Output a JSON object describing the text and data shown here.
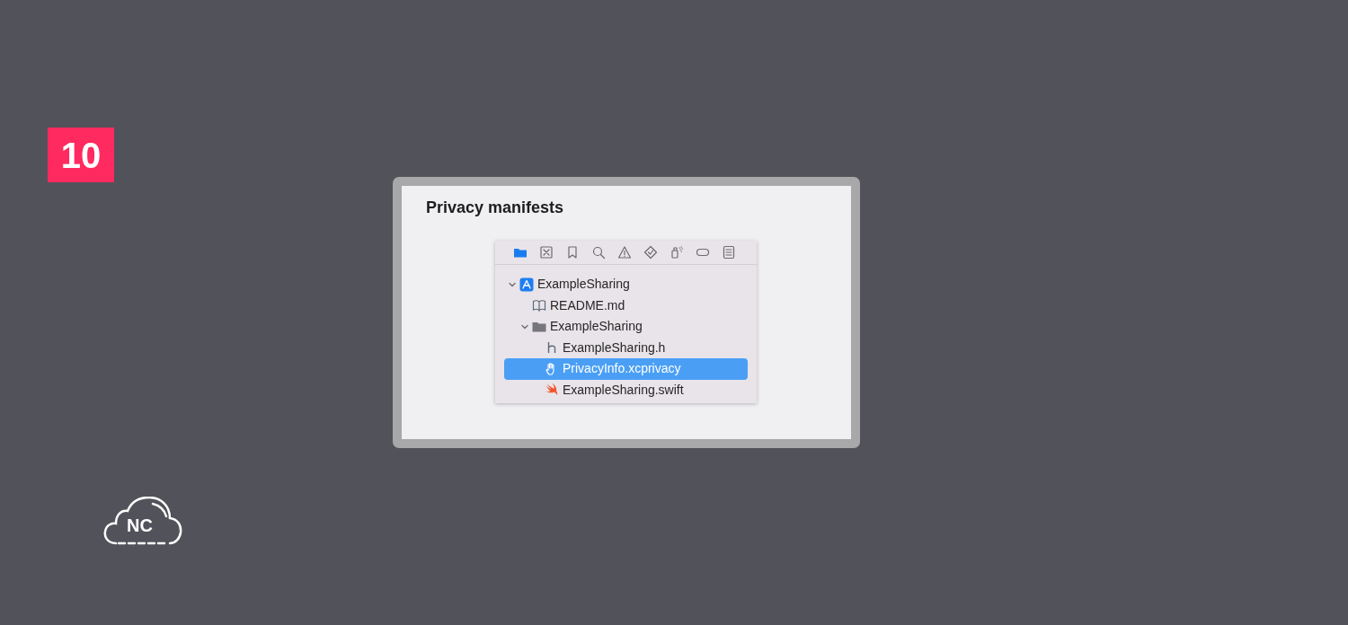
{
  "badge": {
    "number": "10"
  },
  "slide": {
    "title": "Privacy manifests",
    "navigator": {
      "toolbar": [
        {
          "kind": "folder",
          "selected": true
        },
        {
          "kind": "xbox",
          "selected": false
        },
        {
          "kind": "bookmark",
          "selected": false
        },
        {
          "kind": "search",
          "selected": false
        },
        {
          "kind": "warning",
          "selected": false
        },
        {
          "kind": "diamond",
          "selected": false
        },
        {
          "kind": "spray",
          "selected": false
        },
        {
          "kind": "capsule",
          "selected": false
        },
        {
          "kind": "list",
          "selected": false
        }
      ],
      "tree": [
        {
          "label": "ExampleSharing",
          "kind": "project",
          "expanded": true,
          "selected": false,
          "children": [
            {
              "label": "README.md",
              "kind": "book",
              "selected": false
            },
            {
              "label": "ExampleSharing",
              "kind": "folder",
              "expanded": true,
              "selected": false,
              "children": [
                {
                  "label": "ExampleSharing.h",
                  "kind": "header",
                  "selected": false
                },
                {
                  "label": "PrivacyInfo.xcprivacy",
                  "kind": "privacy",
                  "selected": true
                },
                {
                  "label": "ExampleSharing.swift",
                  "kind": "swift",
                  "selected": false
                }
              ]
            }
          ]
        }
      ]
    }
  },
  "logo": {
    "text": "NC"
  }
}
